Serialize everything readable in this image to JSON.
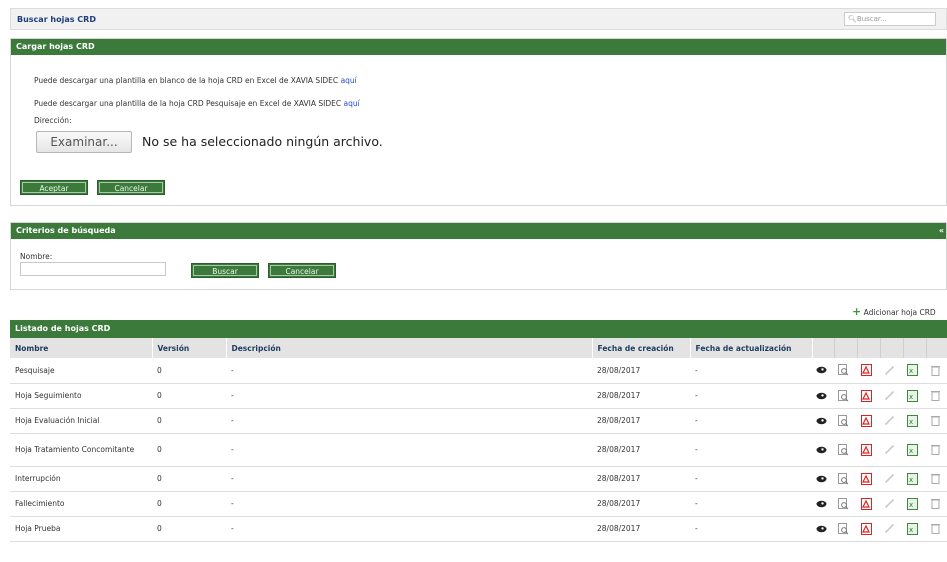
{
  "header": {
    "title": "Buscar hojas CRD",
    "search_placeholder": "Buscar..."
  },
  "upload_panel": {
    "title": "Cargar hojas CRD",
    "line1_text": "Puede descargar una plantilla en blanco de la hoja CRD en Excel de XAVIA SIDEC",
    "line1_link": "aquí",
    "line2_text": "Puede descargar una plantilla de la hoja CRD Pesquisaje en Excel de XAVIA SIDEC",
    "line2_link": "aquí",
    "description_label": "Dirección:",
    "file_button": "Examinar...",
    "file_status": "No se ha seleccionado ningún archivo.",
    "accept_button": "Aceptar",
    "cancel_button": "Cancelar"
  },
  "search_panel": {
    "title": "Criterios de búsqueda",
    "collapse_glyph": "«",
    "name_label": "Nombre:",
    "name_value": "",
    "search_button": "Buscar",
    "cancel_button": "Cancelar"
  },
  "add_link": "Adicionar hoja CRD",
  "list": {
    "title": "Listado de hojas CRD",
    "columns": [
      "Nombre",
      "Versión",
      "Descripción",
      "Fecha de creación",
      "Fecha de actualización"
    ],
    "rows": [
      {
        "name": "Pesquisaje",
        "version": "0",
        "description": "-",
        "created": "28/08/2017",
        "updated": "-"
      },
      {
        "name": "Hoja Seguimiento",
        "version": "0",
        "description": "-",
        "created": "28/08/2017",
        "updated": "-"
      },
      {
        "name": "Hoja Evaluación Inicial",
        "version": "0",
        "description": "-",
        "created": "28/08/2017",
        "updated": "-"
      },
      {
        "name": "Hoja Tratamiento Concomitante",
        "version": "0",
        "description": "-",
        "created": "28/08/2017",
        "updated": "-"
      },
      {
        "name": "Interrupción",
        "version": "0",
        "description": "-",
        "created": "28/08/2017",
        "updated": "-"
      },
      {
        "name": "Fallecimiento",
        "version": "0",
        "description": "-",
        "created": "28/08/2017",
        "updated": "-"
      },
      {
        "name": "Hoja Prueba",
        "version": "0",
        "description": "-",
        "created": "28/08/2017",
        "updated": "-"
      }
    ],
    "row_icons": [
      "eye-icon",
      "preview-icon",
      "pdf-icon",
      "edit-icon",
      "excel-icon",
      "delete-icon"
    ]
  },
  "colors": {
    "green_bar": "#3c7a3c",
    "title_blue": "#1e3d7a",
    "link_blue": "#2a4bd1"
  }
}
